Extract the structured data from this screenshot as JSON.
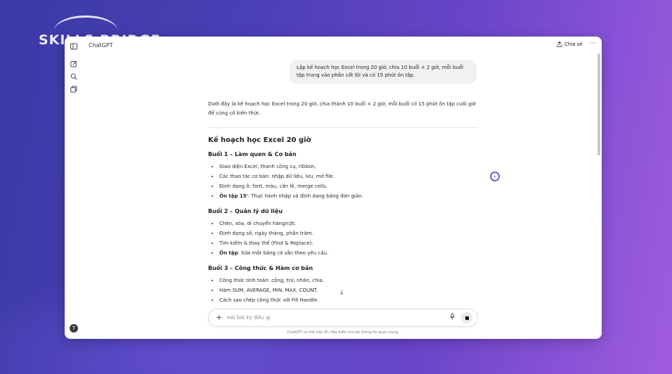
{
  "brand": {
    "logo_text": "SKILLS BRIDGE"
  },
  "header": {
    "title": "ChatGPT",
    "share_label": "Chia sẻ",
    "more_label": "···"
  },
  "user_avatar": "T",
  "conversation": {
    "user_message": "Lập kế hoạch học Excel trong 20 giờ, chia 10 buổi × 2 giờ, mỗi buổi tập trung vào phần cốt lõi và có 15 phút ôn tập.",
    "intro": "Dưới đây là kế hoạch học Excel trong 20 giờ, chia thành 10 buổi × 2 giờ, mỗi buổi có 15 phút ôn tập cuối giờ để củng cố kiến thức.",
    "plan_title": "Kế hoạch học Excel 20 giờ",
    "sessions": [
      {
        "title": "Buổi 1 – Làm quen & Cơ bản",
        "items": [
          "Giao diện Excel, thanh công cụ, ribbon.",
          "Các thao tác cơ bản: nhập dữ liệu, lưu, mở file.",
          "Định dạng ô: font, màu, căn lề, merge cells."
        ],
        "review_label": "Ôn tập 15'",
        "review_text": ": Thực hành nhập và định dạng bảng đơn giản."
      },
      {
        "title": "Buổi 2 – Quản lý dữ liệu",
        "items": [
          "Chèn, xóa, di chuyển hàng/cột.",
          "Định dạng số, ngày tháng, phần trăm.",
          "Tìm kiếm & thay thế (Find & Replace)."
        ],
        "review_label": "Ôn tập",
        "review_text": ": Sửa một bảng có sẵn theo yêu cầu."
      },
      {
        "title": "Buổi 3 – Công thức & Hàm cơ bản",
        "items": [
          "Công thức tính toán: cộng, trừ, nhân, chia.",
          "Hàm SUM, AVERAGE, MIN, MAX, COUNT.",
          "Cách sao chép công thức với Fill Handle."
        ]
      }
    ]
  },
  "composer": {
    "placeholder": "Hỏi bất kỳ điều gì"
  },
  "disclaimer": "ChatGPT có thể mắc lỗi. Hãy kiểm tra các thông tin quan trọng."
}
